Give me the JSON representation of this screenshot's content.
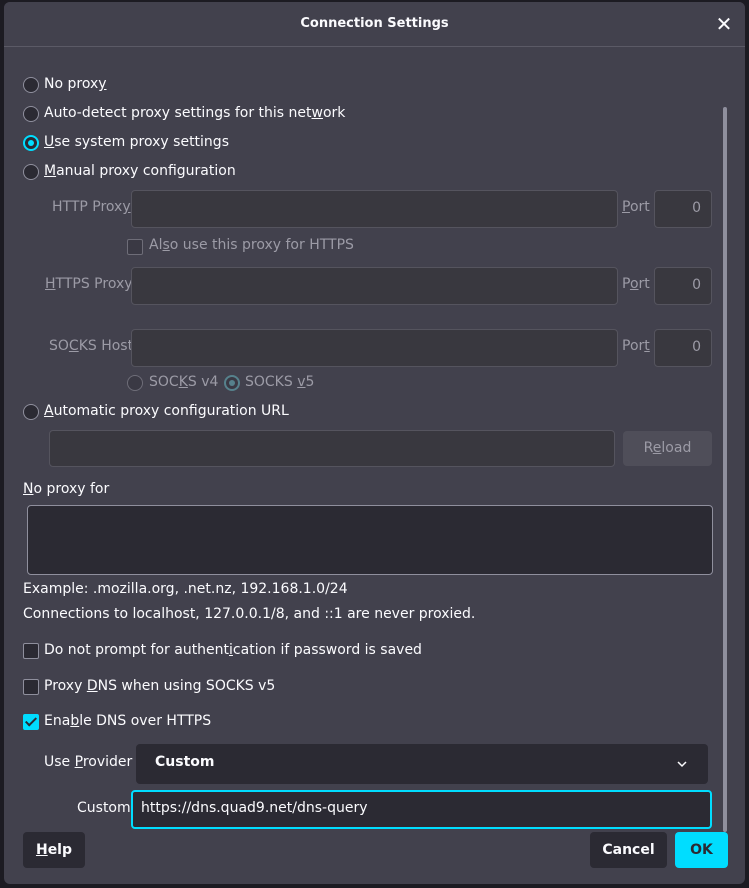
{
  "dialog": {
    "title": "Connection Settings",
    "close_glyph": "✕"
  },
  "proxy": {
    "options": [
      {
        "pre": "No prox",
        "u": "y",
        "post": "",
        "checked": false
      },
      {
        "pre": "Auto-detect proxy settings for this net",
        "u": "w",
        "post": "ork",
        "checked": false
      },
      {
        "pre": "",
        "u": "U",
        "post": "se system proxy settings",
        "checked": true
      },
      {
        "pre": "",
        "u": "M",
        "post": "anual proxy configuration",
        "checked": false
      }
    ],
    "http_proxy": {
      "pre": "HTTP Prox",
      "u": "y",
      "post": "",
      "value": "",
      "port_pre": "",
      "port_u": "P",
      "port_post": "ort",
      "port_value": "0"
    },
    "also_use": {
      "pre": "Al",
      "u": "s",
      "post": "o use this proxy for HTTPS",
      "checked": false
    },
    "https_proxy": {
      "pre": "",
      "u": "H",
      "post": "TTPS Proxy",
      "value": "",
      "port_pre": "P",
      "port_u": "o",
      "port_post": "rt",
      "port_value": "0"
    },
    "socks_host": {
      "pre": "SO",
      "u": "C",
      "post": "KS Host",
      "value": "",
      "port_pre": "Por",
      "port_u": "t",
      "port_post": "",
      "port_value": "0"
    },
    "socks_v4": {
      "pre": "SOC",
      "u": "K",
      "post": "S v4",
      "checked": false
    },
    "socks_v5": {
      "pre": "SOCKS ",
      "u": "v",
      "post": "5",
      "checked": true
    },
    "auto_url": {
      "pre": "",
      "u": "A",
      "post": "utomatic proxy configuration URL",
      "value": "",
      "checked": false
    },
    "reload": {
      "pre": "R",
      "u": "e",
      "post": "load"
    }
  },
  "no_proxy": {
    "pre": "",
    "u": "N",
    "post": "o proxy for",
    "value": "",
    "example": "Example: .mozilla.org, .net.nz, 192.168.1.0/24",
    "localhost_note": "Connections to localhost, 127.0.0.1/8, and ::1 are never proxied."
  },
  "options": {
    "no_prompt": {
      "pre": "Do not prompt for authent",
      "u": "i",
      "post": "cation if password is saved",
      "checked": false
    },
    "proxy_dns": {
      "pre": "Proxy ",
      "u": "D",
      "post": "NS when using SOCKS v5",
      "checked": false
    },
    "doh": {
      "pre": "Ena",
      "u": "b",
      "post": "le DNS over HTTPS",
      "checked": true
    }
  },
  "dns": {
    "provider_pre": "Use ",
    "provider_u": "P",
    "provider_post": "rovider",
    "provider_value": "Custom",
    "custom_label": "Custom",
    "custom_value": "https://dns.quad9.net/dns-query"
  },
  "footer": {
    "help_pre": "",
    "help_u": "H",
    "help_post": "elp",
    "cancel": "Cancel",
    "ok": "OK"
  },
  "colors": {
    "accent": "#00ddff",
    "dialog_bg": "#42414d",
    "field_bg": "#39383f"
  }
}
